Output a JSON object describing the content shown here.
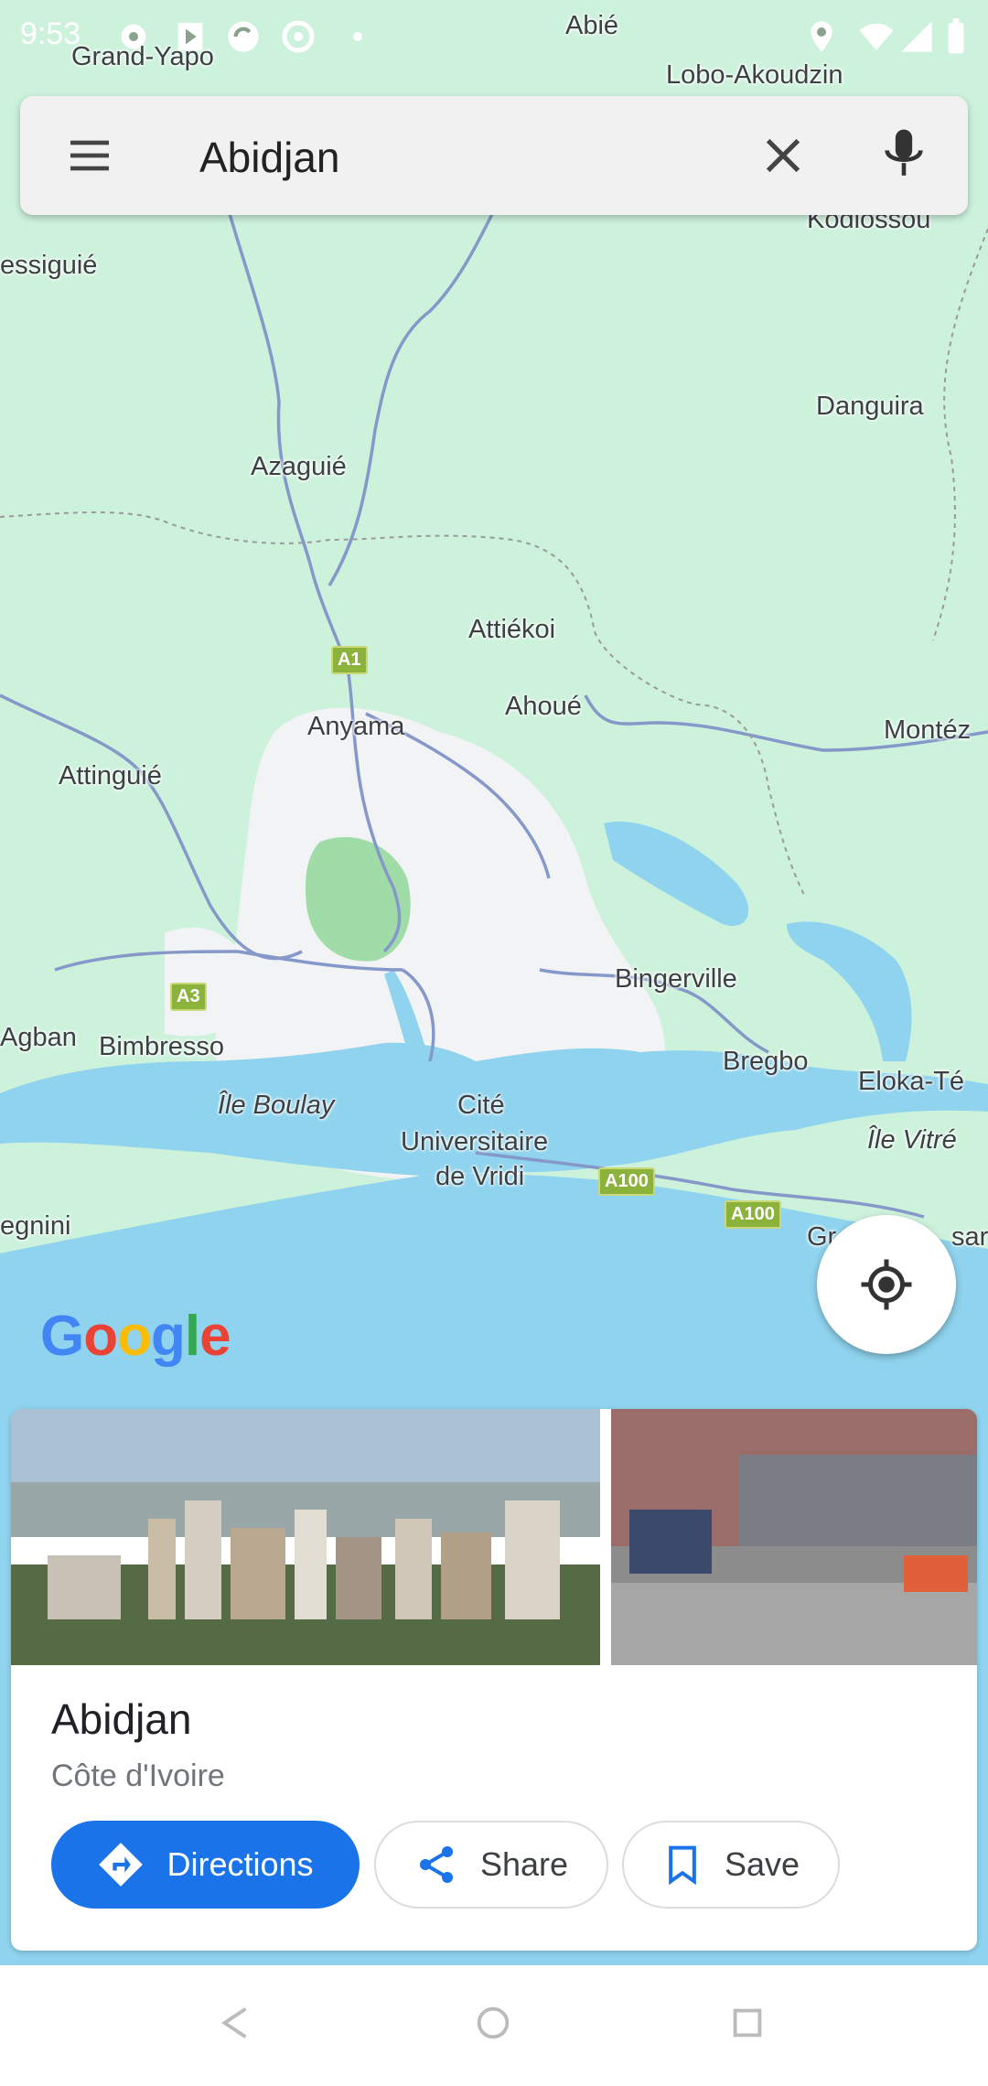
{
  "status_bar": {
    "time": "9:53",
    "icons": [
      "settings-icon",
      "play-icon",
      "sync-icon",
      "at-icon",
      "dot-icon",
      "location-icon",
      "wifi-icon",
      "signal-icon",
      "battery-icon"
    ]
  },
  "search": {
    "query": "Abidjan",
    "menu_icon": "menu-icon",
    "clear_icon": "close-icon",
    "mic_icon": "mic-icon"
  },
  "map": {
    "labels": {
      "grand_yapo": "Grand-Yapo",
      "abie": "Abié",
      "lobo": "Lobo-Akoudzin",
      "kodiossou": "Kodiossou",
      "essiguie": "essiguié",
      "danguira": "Danguira",
      "azaguie": "Azaguié",
      "attiekoi": "Attiékoi",
      "anyama": "Anyama",
      "ahoue": "Ahoué",
      "monteze": "Montéz",
      "attinguie": "Attinguié",
      "bingerville": "Bingerville",
      "agban": "Agban",
      "bimbresso": "Bimbresso",
      "bregbo": "Bregbo",
      "eloka": "Eloka-Té",
      "ile_boulay": "Île Boulay",
      "cite_1": "Cité",
      "cite_2": "Universitaire",
      "cite_3": "de Vridi",
      "ile_vitre": "Île Vitré",
      "egnini": "egnini",
      "grand_bassam": "Gr",
      "grand_bassam_2": "sar"
    },
    "shields": {
      "a1": "A1",
      "a3": "A3",
      "a100_1": "A100",
      "a100_2": "A100"
    },
    "logo": "Google",
    "colors": {
      "land": "#cdf2dc",
      "urban": "#f1f3f4",
      "water": "#8fd3ee",
      "road": "#8598c9"
    }
  },
  "place": {
    "name": "Abidjan",
    "subtitle": "Côte d'Ivoire",
    "buttons": {
      "directions": "Directions",
      "share": "Share",
      "save": "Save"
    }
  },
  "nav": {
    "icons": [
      "back-icon",
      "home-icon",
      "recents-icon"
    ]
  }
}
